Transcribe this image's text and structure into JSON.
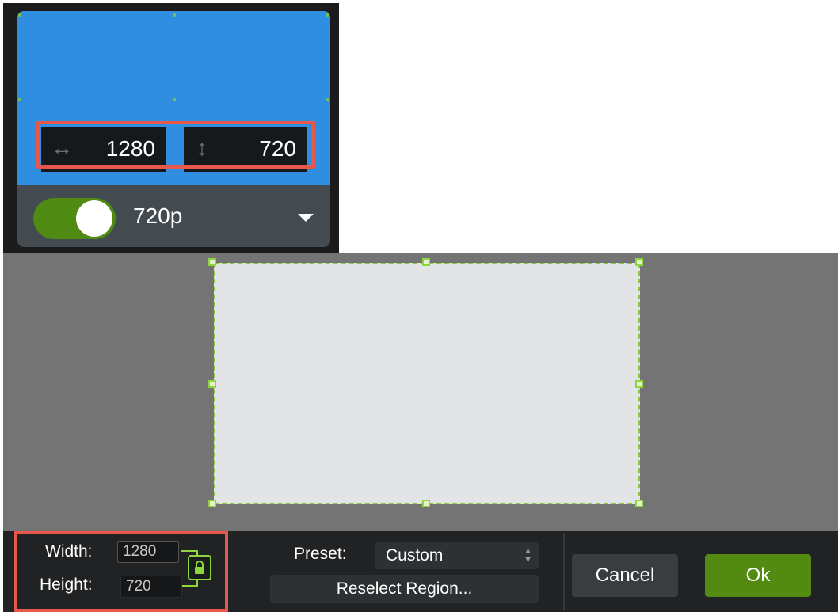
{
  "top_panel": {
    "width_value": "1280",
    "height_value": "720",
    "width_icon": "horizontal-resize-arrow",
    "height_icon": "vertical-resize-arrow",
    "toggle_on": true,
    "resolution_label": "720p",
    "dropdown_icon": "caret-down"
  },
  "bottom_panel": {
    "width_label": "Width:",
    "width_value": "1280",
    "height_label": "Height:",
    "height_value": "720",
    "lock_icon": "lock",
    "preset_label": "Preset:",
    "preset_value": "Custom",
    "reselect_label": "Reselect Region...",
    "cancel_label": "Cancel",
    "ok_label": "Ok"
  },
  "colors": {
    "blue_canvas": "#2f8ee0",
    "highlight": "#e8574c",
    "accent_green": "#538a12",
    "handle_green": "#8fd63c"
  }
}
